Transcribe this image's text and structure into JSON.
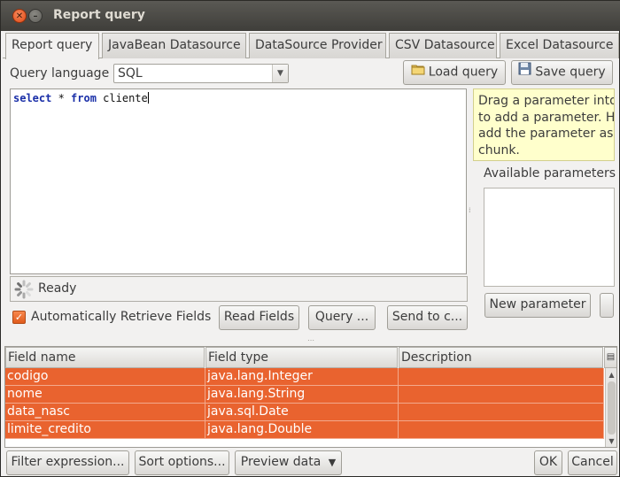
{
  "window": {
    "title": "Report query"
  },
  "tabs": [
    {
      "label": "Report query"
    },
    {
      "label": "JavaBean Datasource"
    },
    {
      "label": "DataSource Provider"
    },
    {
      "label": "CSV Datasource"
    },
    {
      "label": "Excel Datasource"
    }
  ],
  "query": {
    "language_label": "Query language",
    "language_value": "SQL",
    "load_label": "Load query",
    "save_label": "Save query",
    "code_kw1": "select",
    "code_mid": " * ",
    "code_kw2": "from",
    "code_rest": " cliente"
  },
  "status": {
    "text": "Ready"
  },
  "options": {
    "auto_retrieve_label": "Automatically Retrieve Fields",
    "auto_retrieve_checked": true,
    "read_fields_label": "Read Fields",
    "query_designer_label": "Query ...",
    "send_label": "Send to c..."
  },
  "params": {
    "tooltip_lines": [
      "Drag a parameter into",
      "to add a parameter. H",
      "add the parameter as",
      "chunk."
    ],
    "available_label": "Available parameters",
    "new_param_label": "New parameter"
  },
  "fields": {
    "columns": [
      "Field name",
      "Field type",
      "Description"
    ],
    "rows": [
      [
        "codigo",
        "java.lang.Integer",
        ""
      ],
      [
        "nome",
        "java.lang.String",
        ""
      ],
      [
        "data_nasc",
        "java.sql.Date",
        ""
      ],
      [
        "limite_credito",
        "java.lang.Double",
        ""
      ]
    ]
  },
  "footer": {
    "filter_label": "Filter expression...",
    "sort_label": "Sort options...",
    "preview_label": "Preview data",
    "ok_label": "OK",
    "cancel_label": "Cancel"
  },
  "colors": {
    "selection": "#e9632f",
    "tooltip_bg": "#ffffcc"
  }
}
